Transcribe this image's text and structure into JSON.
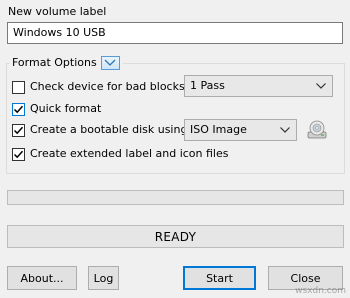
{
  "volume": {
    "label": "New volume label",
    "value": "Windows 10 USB"
  },
  "format_options": {
    "title": "Format Options",
    "options": [
      {
        "label": "Check device for bad blocks",
        "checked": false
      },
      {
        "label": "Quick format",
        "checked": true
      },
      {
        "label": "Create a bootable disk using",
        "checked": true
      },
      {
        "label": "Create extended label and icon files",
        "checked": true
      }
    ],
    "bad_block_passes": "1 Pass",
    "boot_image_type": "ISO Image"
  },
  "status": {
    "text": "READY",
    "progress_percent": 0
  },
  "buttons": {
    "about": "About...",
    "log": "Log",
    "start": "Start",
    "close": "Close"
  },
  "colors": {
    "window_bg": "#f0f0f0",
    "accent": "#0078d7"
  },
  "watermark": "wsxdn.com"
}
